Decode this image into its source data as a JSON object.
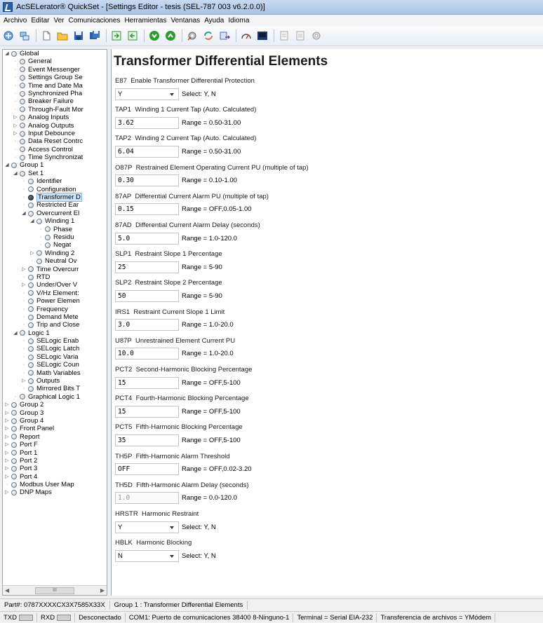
{
  "window": {
    "title": "AcSELerator® QuickSet - [Settings Editor - tesis (SEL-787 003 v6.2.0.0)]"
  },
  "menu": [
    "Archivo",
    "Editar",
    "Ver",
    "Comunicaciones",
    "Herramientas",
    "Ventanas",
    "Ayuda",
    "Idioma"
  ],
  "toolbar": {
    "icons": [
      "connect-icon",
      "network-icon",
      "new-icon",
      "open-folder-icon",
      "save-icon",
      "save-all-icon",
      "send-icon",
      "read-icon",
      "go-green-icon",
      "up-green-icon",
      "settings-gear-icon",
      "refresh-icon",
      "transfer-icon",
      "hmi-icon",
      "terminal-icon",
      "report-icon",
      "document-icon",
      "options-icon"
    ],
    "colors": {
      "green": "#2f9a2f",
      "blue": "#2a5fae"
    }
  },
  "tree": {
    "scroll_thumb": "III",
    "nodes": [
      {
        "label": "Global",
        "depth": 0,
        "exp": "open"
      },
      {
        "label": "General",
        "depth": 1,
        "exp": ""
      },
      {
        "label": "Event Messenger",
        "depth": 1,
        "exp": ""
      },
      {
        "label": "Settings Group Se",
        "depth": 1,
        "exp": ""
      },
      {
        "label": "Time and Date Ma",
        "depth": 1,
        "exp": ""
      },
      {
        "label": "Synchronized Pha",
        "depth": 1,
        "exp": ""
      },
      {
        "label": "Breaker Failure",
        "depth": 1,
        "exp": ""
      },
      {
        "label": "Through-Fault Mor",
        "depth": 1,
        "exp": ""
      },
      {
        "label": "Analog Inputs",
        "depth": 1,
        "exp": "closed"
      },
      {
        "label": "Analog Outputs",
        "depth": 1,
        "exp": "closed"
      },
      {
        "label": "Input Debounce",
        "depth": 1,
        "exp": "closed"
      },
      {
        "label": "Data Reset Contrc",
        "depth": 1,
        "exp": ""
      },
      {
        "label": "Access Control",
        "depth": 1,
        "exp": ""
      },
      {
        "label": "Time Synchronizat",
        "depth": 1,
        "exp": ""
      },
      {
        "label": "Group 1",
        "depth": 0,
        "exp": "open"
      },
      {
        "label": "Set 1",
        "depth": 1,
        "exp": "open"
      },
      {
        "label": "Identifier",
        "depth": 2,
        "exp": ""
      },
      {
        "label": "Configuration",
        "depth": 2,
        "exp": ""
      },
      {
        "label": "Transformer D",
        "depth": 2,
        "exp": "",
        "selected": true
      },
      {
        "label": "Restricted Ear",
        "depth": 2,
        "exp": ""
      },
      {
        "label": "Overcurrent El",
        "depth": 2,
        "exp": "open"
      },
      {
        "label": "Winding 1",
        "depth": 3,
        "exp": "open"
      },
      {
        "label": "Phase",
        "depth": 4,
        "exp": ""
      },
      {
        "label": "Residu",
        "depth": 4,
        "exp": ""
      },
      {
        "label": "Negat",
        "depth": 4,
        "exp": ""
      },
      {
        "label": "Winding 2",
        "depth": 3,
        "exp": "closed"
      },
      {
        "label": "Neutral Ov",
        "depth": 3,
        "exp": ""
      },
      {
        "label": "Time Overcurr",
        "depth": 2,
        "exp": "closed"
      },
      {
        "label": "RTD",
        "depth": 2,
        "exp": ""
      },
      {
        "label": "Under/Over V",
        "depth": 2,
        "exp": "closed"
      },
      {
        "label": "V/Hz Element:",
        "depth": 2,
        "exp": ""
      },
      {
        "label": "Power Elemen",
        "depth": 2,
        "exp": ""
      },
      {
        "label": "Frequency",
        "depth": 2,
        "exp": ""
      },
      {
        "label": "Demand Mete",
        "depth": 2,
        "exp": ""
      },
      {
        "label": "Trip and Close",
        "depth": 2,
        "exp": ""
      },
      {
        "label": "Logic 1",
        "depth": 1,
        "exp": "open"
      },
      {
        "label": "SELogic Enab",
        "depth": 2,
        "exp": ""
      },
      {
        "label": "SELogic Latch",
        "depth": 2,
        "exp": ""
      },
      {
        "label": "SELogic Varia",
        "depth": 2,
        "exp": ""
      },
      {
        "label": "SELogic Coun",
        "depth": 2,
        "exp": ""
      },
      {
        "label": "Math Variables",
        "depth": 2,
        "exp": ""
      },
      {
        "label": "Outputs",
        "depth": 2,
        "exp": "closed"
      },
      {
        "label": "Mirrored Bits T",
        "depth": 2,
        "exp": ""
      },
      {
        "label": "Graphical Logic 1",
        "depth": 1,
        "exp": ""
      },
      {
        "label": "Group 2",
        "depth": 0,
        "exp": "closed"
      },
      {
        "label": "Group 3",
        "depth": 0,
        "exp": "closed"
      },
      {
        "label": "Group 4",
        "depth": 0,
        "exp": "closed"
      },
      {
        "label": "Front Panel",
        "depth": 0,
        "exp": "closed"
      },
      {
        "label": "Report",
        "depth": 0,
        "exp": "closed"
      },
      {
        "label": "Port F",
        "depth": 0,
        "exp": "closed"
      },
      {
        "label": "Port 1",
        "depth": 0,
        "exp": "closed"
      },
      {
        "label": "Port 2",
        "depth": 0,
        "exp": "closed"
      },
      {
        "label": "Port 3",
        "depth": 0,
        "exp": "closed"
      },
      {
        "label": "Port 4",
        "depth": 0,
        "exp": "closed"
      },
      {
        "label": "Modbus User Map",
        "depth": 0,
        "exp": ""
      },
      {
        "label": "DNP Maps",
        "depth": 0,
        "exp": "closed"
      }
    ]
  },
  "editor": {
    "title": "Transformer Differential Elements",
    "settings": [
      {
        "code": "E87",
        "desc": "Enable Transformer Differential Protection",
        "value": "Y",
        "type": "combo",
        "hint": "Select: Y, N"
      },
      {
        "code": "TAP1",
        "desc": "Winding 1 Current Tap (Auto. Calculated)",
        "value": "3.62",
        "type": "text",
        "hint": "Range = 0.50-31.00"
      },
      {
        "code": "TAP2",
        "desc": "Winding 2 Current Tap (Auto. Calculated)",
        "value": "6.04",
        "type": "text",
        "hint": "Range = 0.50-31.00"
      },
      {
        "code": "O87P",
        "desc": "Restrained Element Operating Current PU (multiple of tap)",
        "value": "0.30",
        "type": "text",
        "hint": "Range = 0.10-1.00"
      },
      {
        "code": "87AP",
        "desc": "Differential Current Alarm PU (multiple of tap)",
        "value": "0.15",
        "type": "text",
        "hint": "Range = OFF,0.05-1.00"
      },
      {
        "code": "87AD",
        "desc": "Differential Current Alarm Delay (seconds)",
        "value": "5.0",
        "type": "text",
        "hint": "Range = 1.0-120.0"
      },
      {
        "code": "SLP1",
        "desc": "Restraint Slope 1 Percentage",
        "value": "25",
        "type": "text",
        "hint": "Range = 5-90"
      },
      {
        "code": "SLP2",
        "desc": "Restraint Slope 2 Percentage",
        "value": "50",
        "type": "text",
        "hint": "Range = 5-90"
      },
      {
        "code": "IRS1",
        "desc": "Restraint Current Slope 1 Limit",
        "value": "3.0",
        "type": "text",
        "hint": "Range = 1.0-20.0"
      },
      {
        "code": "U87P",
        "desc": "Unrestrained Element Current PU",
        "value": "10.0",
        "type": "text",
        "hint": "Range = 1.0-20.0"
      },
      {
        "code": "PCT2",
        "desc": "Second-Harmonic Blocking Percentage",
        "value": "15",
        "type": "text",
        "hint": "Range = OFF,5-100"
      },
      {
        "code": "PCT4",
        "desc": "Fourth-Harmonic Blocking Percentage",
        "value": "15",
        "type": "text",
        "hint": "Range = OFF,5-100"
      },
      {
        "code": "PCT5",
        "desc": "Fifth-Harmonic Blocking Percentage",
        "value": "35",
        "type": "text",
        "hint": "Range = OFF,5-100"
      },
      {
        "code": "TH5P",
        "desc": "Fifth-Harmonic Alarm Threshold",
        "value": "OFF",
        "type": "text",
        "hint": "Range = OFF,0.02-3.20"
      },
      {
        "code": "TH5D",
        "desc": "Fifth-Harmonic Alarm Delay (seconds)",
        "value": "1.0",
        "type": "disabled",
        "hint": "Range = 0.0-120.0"
      },
      {
        "code": "HRSTR",
        "desc": "Harmonic Restraint",
        "value": "Y",
        "type": "combo",
        "hint": "Select: Y, N"
      },
      {
        "code": "HBLK",
        "desc": "Harmonic Blocking",
        "value": "N",
        "type": "combo",
        "hint": "Select: Y, N"
      }
    ]
  },
  "status1": {
    "part": "Part#: 0787XXXXCX3X7585X33X",
    "location": "Group 1 : Transformer Differential Elements"
  },
  "status2": {
    "txd": "TXD",
    "rxd": "RXD",
    "connection": "Desconectado",
    "port": "COM1: Puerto de comunicaciones",
    "baud": "38400",
    "format": "8-Ninguno-1",
    "terminal": "Terminal = Serial EIA-232",
    "transfer": "Transferencia de archivos = YMódem"
  }
}
